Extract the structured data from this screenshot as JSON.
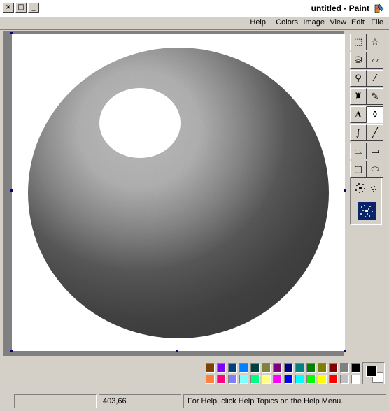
{
  "window": {
    "title": "untitled - Paint"
  },
  "title_controls": [
    "×",
    "□",
    "_"
  ],
  "menu": [
    "File",
    "Edit",
    "View",
    "Image",
    "Colors",
    "Help"
  ],
  "tools": [
    {
      "name": "free-form-select-tool",
      "glyph": "☆",
      "active": false
    },
    {
      "name": "select-tool",
      "glyph": "⬚",
      "active": false
    },
    {
      "name": "eraser-tool",
      "glyph": "▱",
      "active": false
    },
    {
      "name": "fill-tool",
      "glyph": "⛁",
      "active": false
    },
    {
      "name": "pick-color-tool",
      "glyph": "⁄",
      "active": false
    },
    {
      "name": "magnifier-tool",
      "glyph": "⚲",
      "active": false
    },
    {
      "name": "pencil-tool",
      "glyph": "✎",
      "active": false
    },
    {
      "name": "brush-tool",
      "glyph": "♜",
      "active": false
    },
    {
      "name": "airbrush-tool",
      "glyph": "⚱",
      "active": true
    },
    {
      "name": "text-tool",
      "glyph": "A",
      "active": false
    },
    {
      "name": "line-tool",
      "glyph": "╱",
      "active": false
    },
    {
      "name": "curve-tool",
      "glyph": "∫",
      "active": false
    },
    {
      "name": "rectangle-tool",
      "glyph": "▭",
      "active": false
    },
    {
      "name": "polygon-tool",
      "glyph": "⏢",
      "active": false
    },
    {
      "name": "ellipse-tool",
      "glyph": "⬭",
      "active": false
    },
    {
      "name": "rounded-rectangle-tool",
      "glyph": "▢",
      "active": false
    }
  ],
  "palette": {
    "top": [
      "#000000",
      "#808080",
      "#800000",
      "#808000",
      "#008000",
      "#008080",
      "#000080",
      "#800080",
      "#808040",
      "#004040",
      "#0080ff",
      "#004080",
      "#8000ff",
      "#804000"
    ],
    "bottom": [
      "#ffffff",
      "#c0c0c0",
      "#ff0000",
      "#ffff00",
      "#00ff00",
      "#00ffff",
      "#0000ff",
      "#ff00ff",
      "#ffff80",
      "#00ff80",
      "#80ffff",
      "#8080ff",
      "#ff0080",
      "#ff8040"
    ]
  },
  "colors": {
    "foreground": "#000000",
    "background": "#ffffff",
    "sphere_dark": "#404040",
    "sphere_light": "#c0c0c0"
  },
  "status": {
    "help_text": "For Help, click Help Topics on the Help Menu.",
    "coords": "403,66",
    "size": ""
  }
}
